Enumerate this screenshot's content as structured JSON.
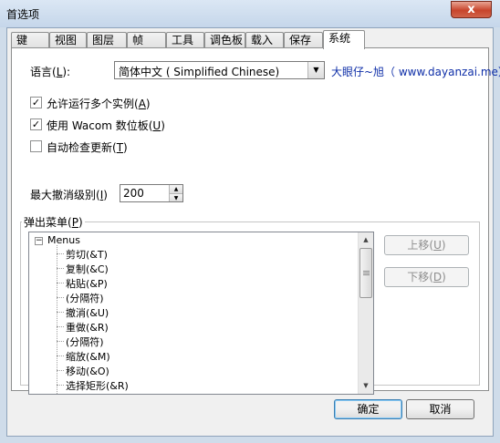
{
  "window": {
    "title": "首选项",
    "close_glyph": "x"
  },
  "tabs": [
    {
      "label": "键"
    },
    {
      "label": "视图"
    },
    {
      "label": "图层"
    },
    {
      "label": "帧"
    },
    {
      "label": "工具"
    },
    {
      "label": "调色板"
    },
    {
      "label": "载入"
    },
    {
      "label": "保存"
    },
    {
      "label": "系统",
      "active": true
    }
  ],
  "language": {
    "label_prefix": "语言(",
    "label_key": "L",
    "label_suffix": "):",
    "value": "简体中文 ( Simplified Chinese)",
    "credit": "大眼仔~旭（ www.dayanzai.me）"
  },
  "options": [
    {
      "prefix": "允许运行多个实例(",
      "key": "A",
      "suffix": ")",
      "checked": true
    },
    {
      "prefix": "使用 Wacom 数位板(",
      "key": "U",
      "suffix": ")",
      "checked": true
    },
    {
      "prefix": "自动检查更新(",
      "key": "T",
      "suffix": ")",
      "checked": false
    }
  ],
  "undo": {
    "label_prefix": "最大撤消级别(",
    "label_key": "I",
    "label_suffix": ")",
    "value": "200"
  },
  "popup_menu": {
    "label_prefix": "弹出菜单(",
    "label_key": "P",
    "label_suffix": ")",
    "root": "Menus",
    "items": [
      "剪切(&T)",
      "复制(&C)",
      "粘贴(&P)",
      "(分隔符)",
      "撤消(&U)",
      "重做(&R)",
      "(分隔符)",
      "缩放(&M)",
      "移动(&O)",
      "选择矩形(&R)"
    ],
    "move_up_prefix": "上移(",
    "move_up_key": "U",
    "move_up_suffix": ")",
    "move_down_prefix": "下移(",
    "move_down_key": "D",
    "move_down_suffix": ")"
  },
  "footer": {
    "ok": "确定",
    "cancel": "取消"
  }
}
